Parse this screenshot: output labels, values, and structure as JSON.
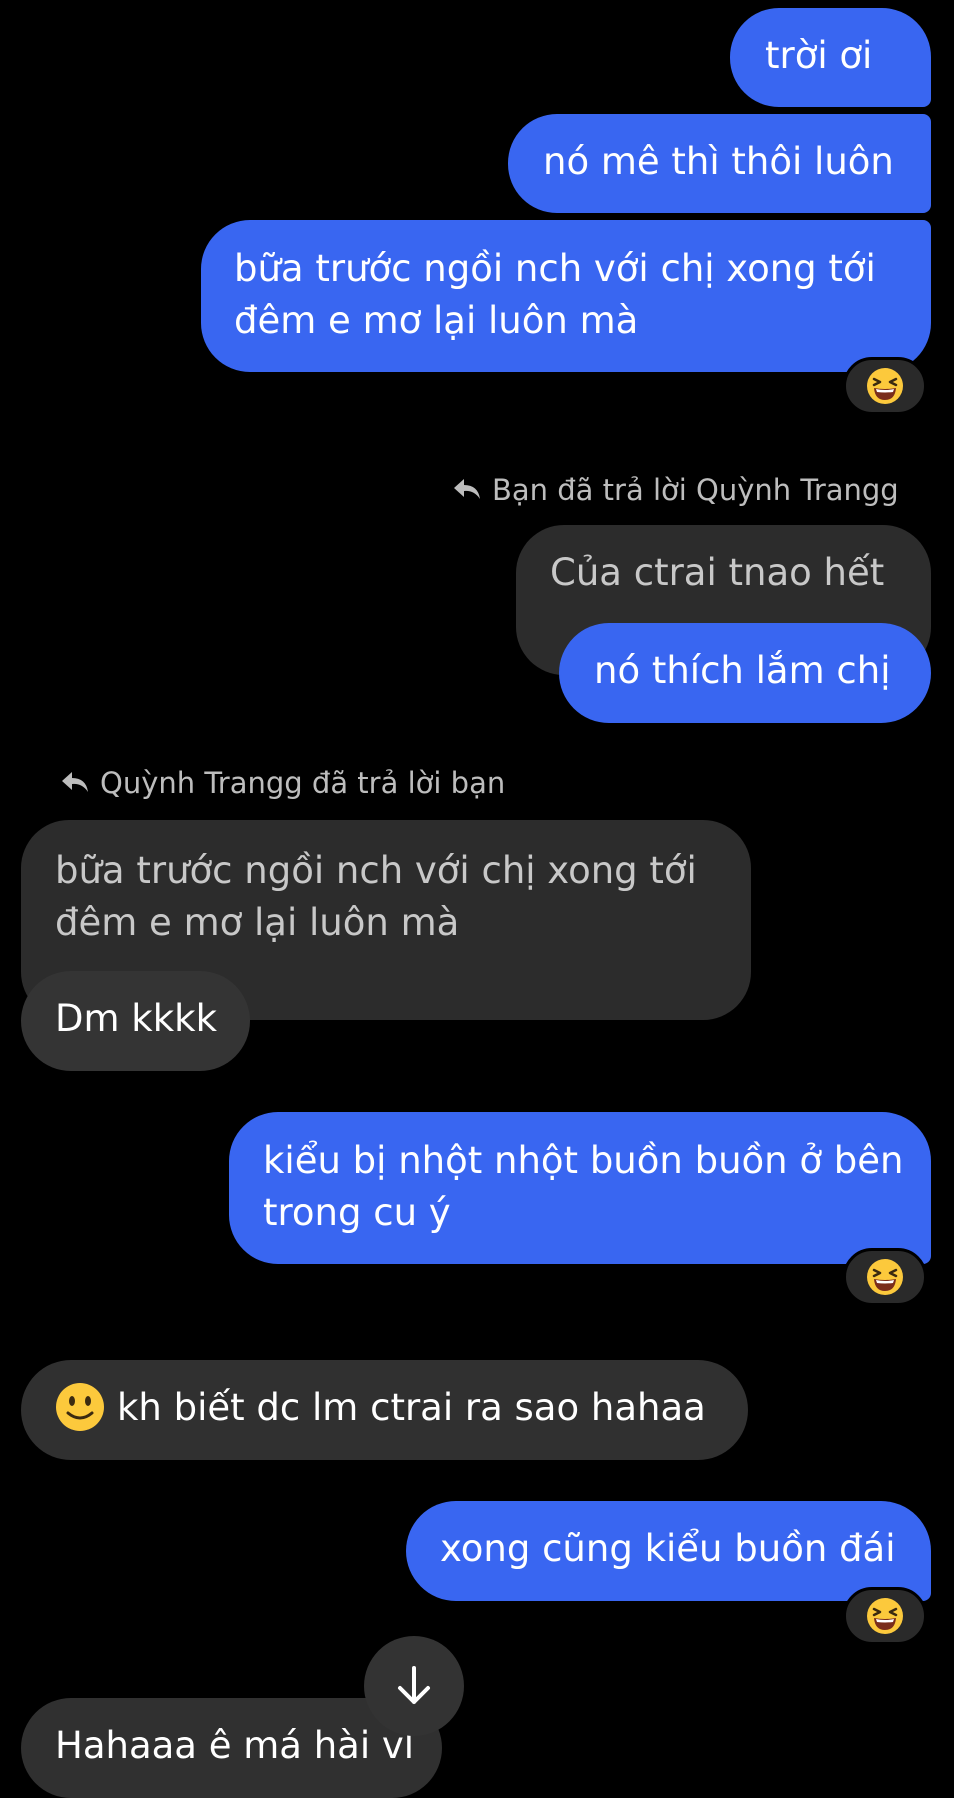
{
  "theme": {
    "background": "#000000",
    "outgoing_bubble": "#3966f1",
    "incoming_bubble": "#303030",
    "quoted_bubble": "#2c2c2c"
  },
  "messages": [
    {
      "id": "m1",
      "direction": "out",
      "text": "trời ơi"
    },
    {
      "id": "m2",
      "direction": "out",
      "text": "nó mê thì thôi luôn"
    },
    {
      "id": "m3",
      "direction": "out",
      "text": "bữa trước ngồi nch với chị xong tới đêm e mơ lại luôn mà",
      "reaction": "laughing-emoji"
    },
    {
      "id": "m4",
      "direction": "out",
      "reply_label": "Bạn đã trả lời Quỳnh Trangg",
      "quoted_text": "Của ctrai tnao hết",
      "text": "nó thích lắm chị"
    },
    {
      "id": "m5",
      "direction": "in",
      "reply_label": "Quỳnh Trangg đã trả lời bạn",
      "quoted_text": "bữa trước ngồi nch với chị xong tới đêm e mơ lại luôn mà",
      "text": "Dm kkkk"
    },
    {
      "id": "m6",
      "direction": "out",
      "text": "kiểu bị nhột nhột buồn buồn ở bên trong cu ý",
      "reaction": "laughing-emoji"
    },
    {
      "id": "m7",
      "direction": "in",
      "emoji": "slightly-smiling-emoji",
      "text": "kh biết dc lm ctrai ra sao hahaa"
    },
    {
      "id": "m8",
      "direction": "out",
      "text": "xong cũng kiểu buồn đái",
      "reaction": "laughing-emoji"
    },
    {
      "id": "m9",
      "direction": "in",
      "text": "Hahaaa ê má hài vl"
    }
  ],
  "scroll_button": {
    "icon": "arrow-down-icon"
  }
}
